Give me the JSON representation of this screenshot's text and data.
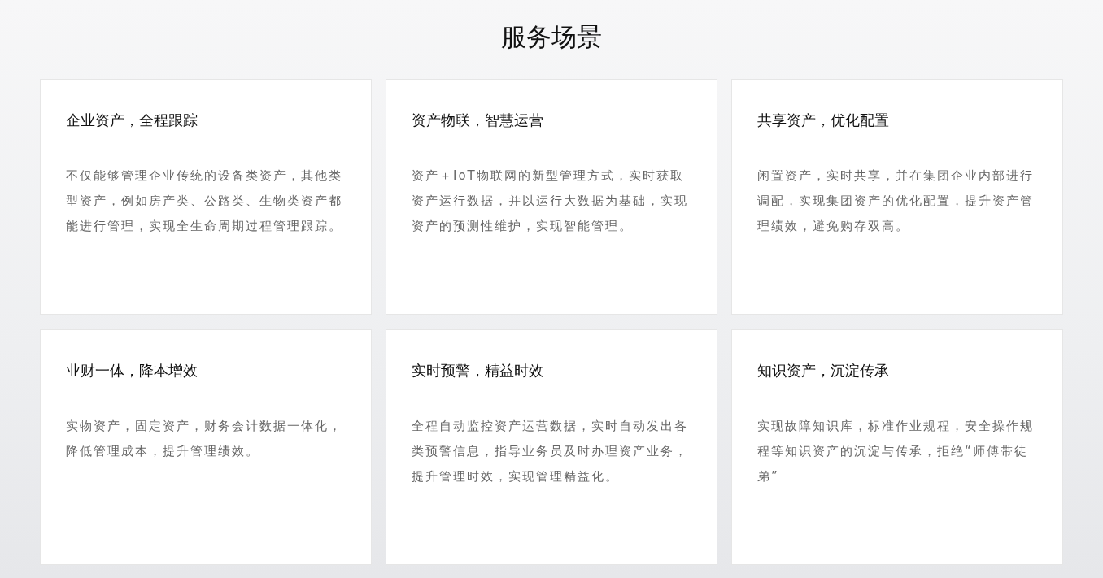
{
  "section": {
    "title": "服务场景"
  },
  "cards": [
    {
      "title": "企业资产，全程跟踪",
      "description": "不仅能够管理企业传统的设备类资产，其他类型资产，例如房产类、公路类、生物类资产都能进行管理，实现全生命周期过程管理跟踪。"
    },
    {
      "title": "资产物联，智慧运营",
      "description": "资产＋IoT物联网的新型管理方式，实时获取资产运行数据，并以运行大数据为基础，实现资产的预测性维护，实现智能管理。"
    },
    {
      "title": "共享资产，优化配置",
      "description": "闲置资产，实时共享，并在集团企业内部进行调配，实现集团资产的优化配置，提升资产管理绩效，避免购存双高。"
    },
    {
      "title": "业财一体，降本增效",
      "description": "实物资产，固定资产，财务会计数据一体化，降低管理成本，提升管理绩效。"
    },
    {
      "title": "实时预警，精益时效",
      "description": "全程自动监控资产运营数据，实时自动发出各类预警信息，指导业务员及时办理资产业务，提升管理时效，实现管理精益化。"
    },
    {
      "title": "知识资产，沉淀传承",
      "description": "实现故障知识库，标准作业规程，安全操作规程等知识资产的沉淀与传承，拒绝“师傅带徒弟”"
    }
  ]
}
